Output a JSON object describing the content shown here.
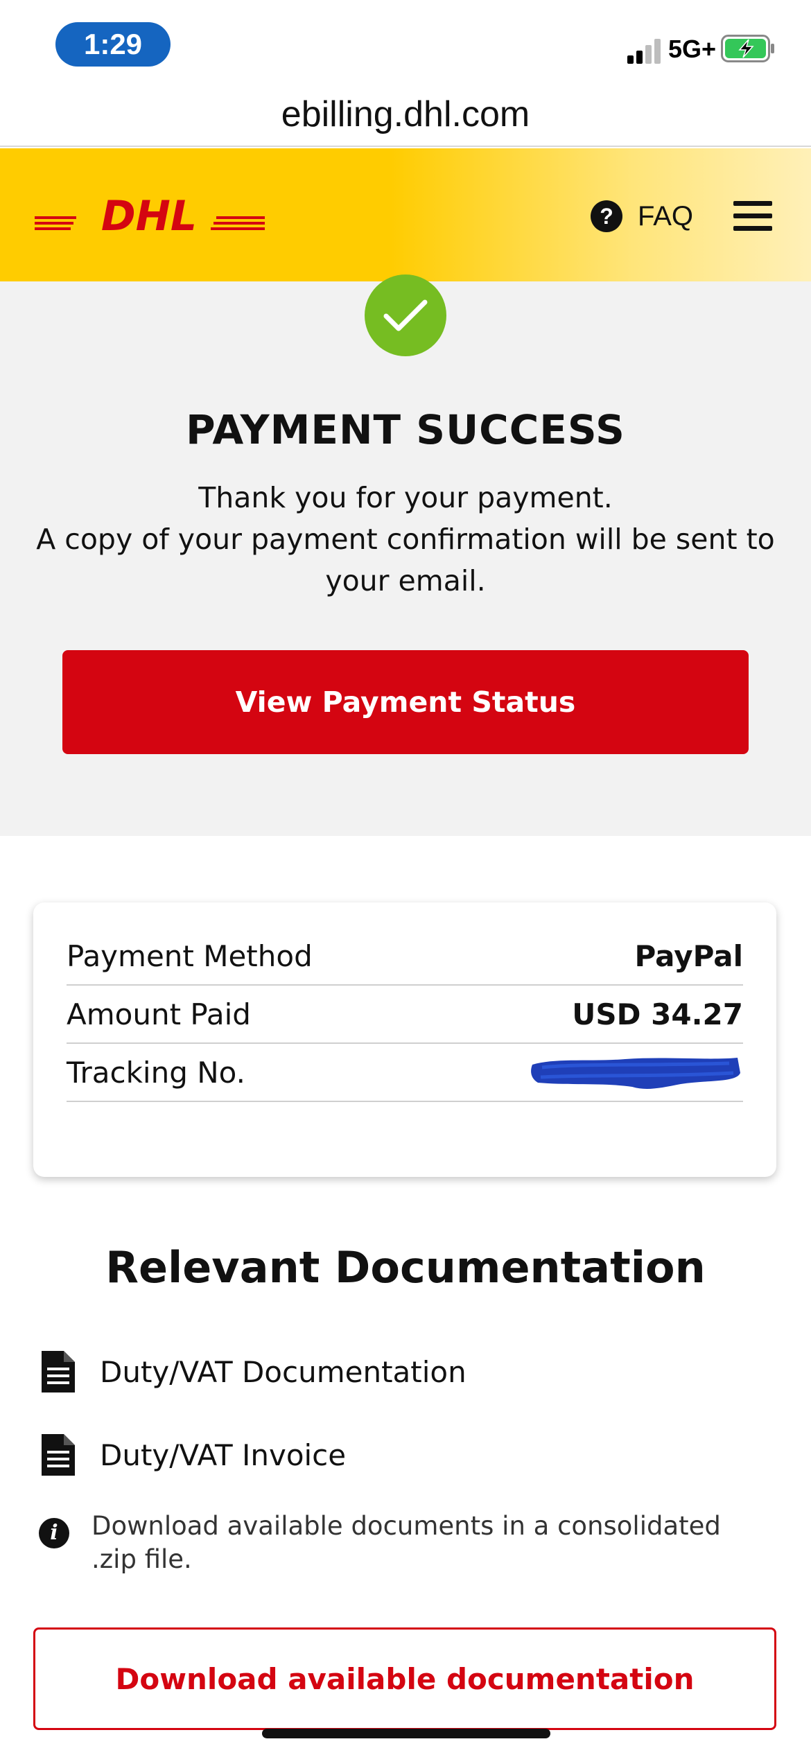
{
  "status_bar": {
    "time": "1:29",
    "network": "5G+"
  },
  "browser": {
    "url": "ebilling.dhl.com"
  },
  "header": {
    "logo_text": "DHL",
    "faq_label": "FAQ",
    "faq_icon": "question-circle-icon",
    "menu_icon": "hamburger-menu-icon"
  },
  "success": {
    "icon": "checkmark-icon",
    "title": "PAYMENT SUCCESS",
    "line1": "Thank you for your payment.",
    "line2": "A copy of your payment confirmation will be sent to your email.",
    "button_label": "View Payment Status"
  },
  "details": {
    "rows": [
      {
        "label": "Payment Method",
        "value": "PayPal"
      },
      {
        "label": "Amount Paid",
        "value": "USD 34.27"
      },
      {
        "label": "Tracking No.",
        "value": ""
      }
    ]
  },
  "documentation": {
    "title": "Relevant Documentation",
    "items": [
      {
        "label": "Duty/VAT Documentation",
        "icon": "document-icon"
      },
      {
        "label": "Duty/VAT Invoice",
        "icon": "document-icon"
      }
    ],
    "info_text": "Download available documents in a consolidated .zip file.",
    "download_label": "Download available documentation"
  },
  "colors": {
    "dhl_yellow": "#ffcc00",
    "dhl_red": "#d40511",
    "success_green": "#76bd22",
    "time_pill_blue": "#1565c0"
  }
}
